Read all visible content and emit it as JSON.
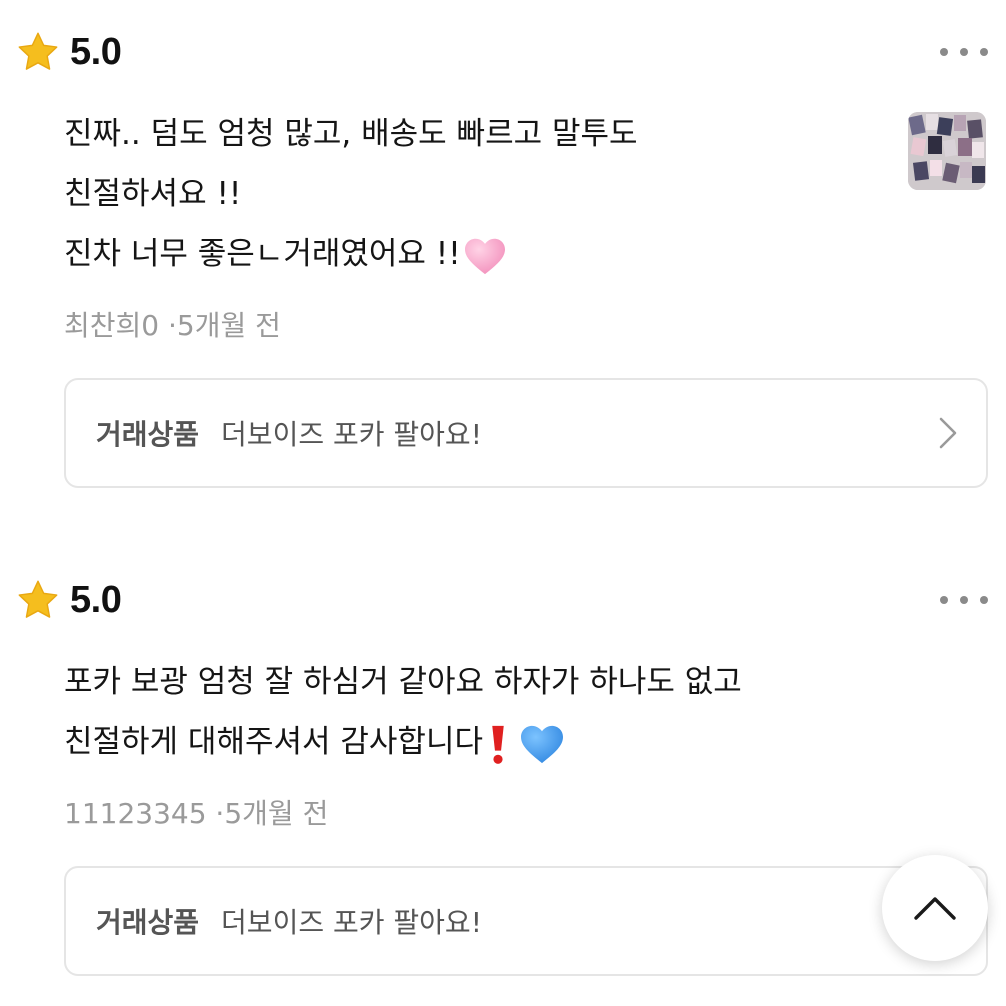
{
  "reviews": [
    {
      "rating": "5.0",
      "lines": [
        "진짜.. 덤도 엄청 많고, 배송도 빠르고 말투도",
        "친절하셔요 !!",
        "진차 너무 좋은ㄴ거래였어요 !!"
      ],
      "line_emoji": "pink-heart-icon",
      "author": "최찬희0",
      "separator": "·",
      "time": "5개월 전",
      "product_label": "거래상품",
      "product_title": "더보이즈 포카 팔아요!"
    },
    {
      "rating": "5.0",
      "lines": [
        "포카 보광 엄청 잘 하심거 같아요 하자가 하나도 없고",
        "친절하게 대해주셔서 감사합니다"
      ],
      "line_emoji": [
        "red-exclamation-icon",
        "blue-heart-icon"
      ],
      "author": "11123345",
      "separator": "·",
      "time": "5개월 전",
      "product_label": "거래상품",
      "product_title": "더보이즈 포카 팔아요!"
    }
  ],
  "colors": {
    "star": "#F5BE1E",
    "pink_heart": "#F7A6C9",
    "blue_heart": "#3E9BEA",
    "red_mark": "#E02020",
    "meta_text": "#9A9A9A",
    "border": "#E5E5E5"
  }
}
